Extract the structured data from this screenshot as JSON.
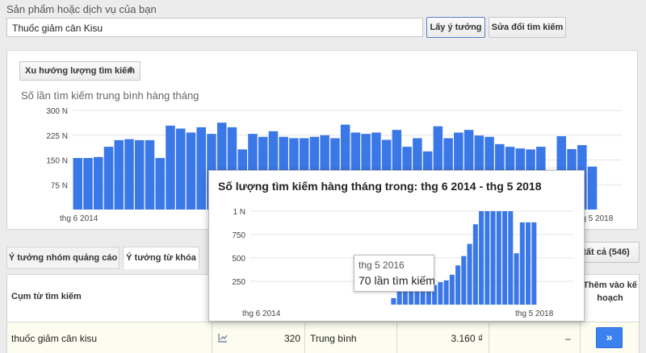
{
  "search": {
    "label": "Sản phẩm hoặc dịch vụ của bạn",
    "value": "Thuốc giảm cân Kisu",
    "get_ideas_button": "Lấy ý tưởng",
    "edit_search_button": "Sửa đổi tìm kiếm"
  },
  "trend": {
    "select_label": "Xu hướng lượng tìm kiếm",
    "chart_title": "Số lần tìm kiếm trung bình hàng tháng"
  },
  "tabs": [
    {
      "label": "Ý tưởng nhóm quảng cáo"
    },
    {
      "label": "Ý tưởng từ khóa"
    }
  ],
  "download_all": "tất cả (546)",
  "table": {
    "header_keyword": "Cụm từ tìm kiếm",
    "header_add": "Thêm vào kế hoạch",
    "row": {
      "keyword": "thuốc giảm cân kisu",
      "avg_searches": "320",
      "competition": "Trung bình",
      "bid": "3.160 ₫",
      "share": "–",
      "add_button": "»"
    }
  },
  "popup": {
    "title": "Số lượng tìm kiếm hàng tháng trong: thg 6 2014 - thg 5 2018",
    "tooltip_date": "thg 5 2016",
    "tooltip_value": "70 lần tìm kiếm"
  },
  "colors": {
    "bar": "#3b78e7",
    "accent": "#3b82f0"
  },
  "chart_data": [
    {
      "type": "bar",
      "title": "Số lần tìm kiếm trung bình hàng tháng",
      "y_ticks": [
        "75 N",
        "150 N",
        "225 N",
        "300 N"
      ],
      "x_ticks": [
        "thg 6 2014",
        "thg 5 2018"
      ],
      "ylim": [
        0,
        300000
      ],
      "grid": true,
      "values": [
        156000,
        156000,
        159000,
        190000,
        210000,
        213000,
        210000,
        210000,
        156000,
        254000,
        245000,
        233000,
        249000,
        229000,
        263000,
        249000,
        182000,
        229000,
        220000,
        237000,
        220000,
        216000,
        216000,
        220000,
        225000,
        216000,
        257000,
        233000,
        229000,
        233000,
        211000,
        241000,
        190000,
        216000,
        176000,
        252000,
        216000,
        233000,
        241000,
        224000,
        220000,
        198000,
        190000,
        185000,
        182000,
        190000,
        60000,
        222000,
        183000,
        195000,
        130000
      ]
    },
    {
      "type": "bar",
      "title": "Số lượng tìm kiếm hàng tháng trong: thg 6 2014 - thg 5 2018",
      "y_ticks": [
        "250",
        "500",
        "750",
        "1 N"
      ],
      "x_ticks": [
        "thg 6 2014",
        "thg 5 2018"
      ],
      "ylim": [
        0,
        1000
      ],
      "grid": true,
      "values": [
        0,
        0,
        0,
        0,
        0,
        0,
        0,
        0,
        0,
        0,
        0,
        0,
        0,
        0,
        0,
        0,
        0,
        0,
        0,
        0,
        0,
        0,
        0,
        0,
        70,
        170,
        170,
        170,
        170,
        170,
        170,
        210,
        240,
        260,
        320,
        420,
        520,
        650,
        860,
        1000,
        1000,
        1000,
        1000,
        1000,
        1000,
        550,
        880,
        880,
        880
      ]
    }
  ]
}
